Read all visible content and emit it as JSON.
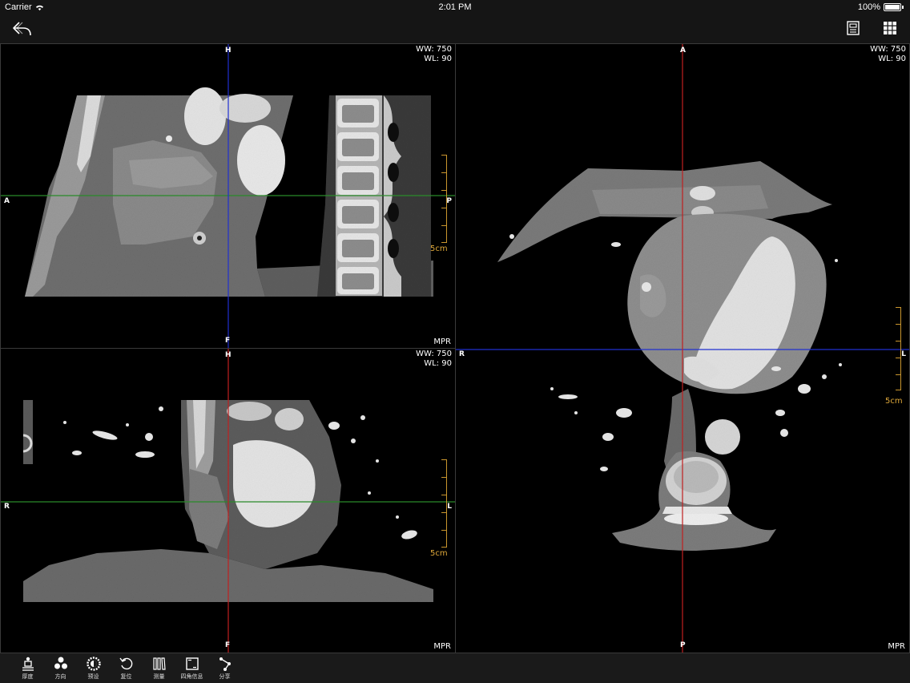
{
  "status_bar": {
    "carrier": "Carrier",
    "time": "2:01 PM",
    "battery": "100%",
    "battery_level": 1.0
  },
  "nav": {
    "back_icon": "back-arrow-icon",
    "series_icon": "series-list-icon",
    "layout_icon": "grid-layout-icon"
  },
  "viewports": {
    "sagittal": {
      "ww": "WW: 750",
      "wl": "WL: 90",
      "label": "MPR",
      "top": "H",
      "bottom": "F",
      "left": "A",
      "right": "P",
      "scale": "5cm"
    },
    "coronal": {
      "ww": "WW: 750",
      "wl": "WL: 90",
      "label": "MPR",
      "top": "H",
      "bottom": "F",
      "left": "R",
      "right": "L",
      "scale": "5cm"
    },
    "axial": {
      "ww": "WW: 750",
      "wl": "WL: 90",
      "label": "MPR",
      "top": "A",
      "bottom": "P",
      "left": "R",
      "right": "L",
      "scale": "5cm"
    }
  },
  "crosshair_colors": {
    "axial_line": "#2a8a2a",
    "coronal_line": "#c02020",
    "sagittal_line": "#2030d0"
  },
  "toolbar": [
    {
      "label": "厚度",
      "icon": "thickness-icon"
    },
    {
      "label": "方向",
      "icon": "orientation-icon"
    },
    {
      "label": "预设",
      "icon": "preset-icon"
    },
    {
      "label": "复位",
      "icon": "reset-icon"
    },
    {
      "label": "测量",
      "icon": "measure-icon"
    },
    {
      "label": "四角信息",
      "icon": "corner-info-icon"
    },
    {
      "label": "分享",
      "icon": "share-icon"
    }
  ]
}
